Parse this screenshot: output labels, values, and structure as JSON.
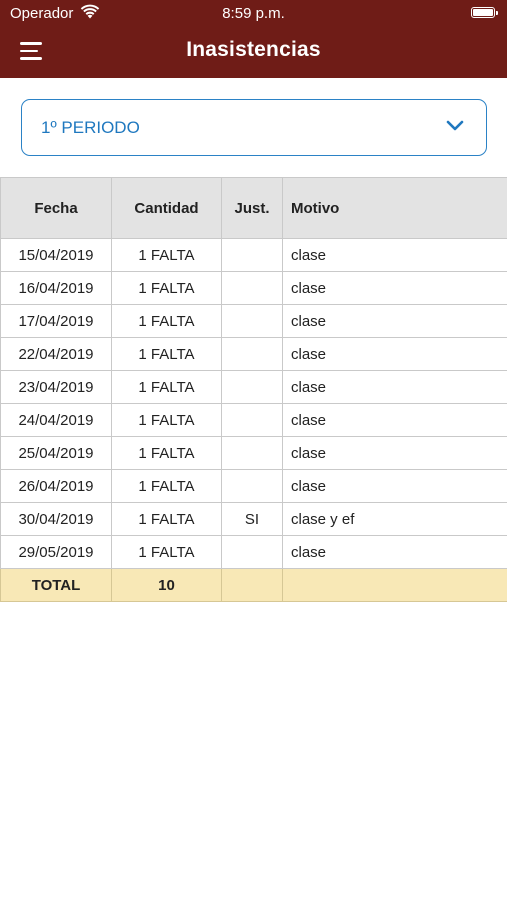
{
  "status_bar": {
    "carrier": "Operador",
    "time": "8:59 p.m."
  },
  "header": {
    "title": "Inasistencias",
    "menu_icon": "hamburger-menu-icon"
  },
  "period_select": {
    "value": "1º PERIODO",
    "icon": "chevron-down-icon"
  },
  "table": {
    "headers": [
      "Fecha",
      "Cantidad",
      "Just.",
      "Motivo"
    ],
    "rows": [
      {
        "fecha": "15/04/2019",
        "cantidad": "1 FALTA",
        "just": "",
        "motivo": "clase"
      },
      {
        "fecha": "16/04/2019",
        "cantidad": "1 FALTA",
        "just": "",
        "motivo": "clase"
      },
      {
        "fecha": "17/04/2019",
        "cantidad": "1 FALTA",
        "just": "",
        "motivo": "clase"
      },
      {
        "fecha": "22/04/2019",
        "cantidad": "1 FALTA",
        "just": "",
        "motivo": "clase"
      },
      {
        "fecha": "23/04/2019",
        "cantidad": "1 FALTA",
        "just": "",
        "motivo": "clase"
      },
      {
        "fecha": "24/04/2019",
        "cantidad": "1 FALTA",
        "just": "",
        "motivo": "clase"
      },
      {
        "fecha": "25/04/2019",
        "cantidad": "1 FALTA",
        "just": "",
        "motivo": "clase"
      },
      {
        "fecha": "26/04/2019",
        "cantidad": "1 FALTA",
        "just": "",
        "motivo": "clase"
      },
      {
        "fecha": "30/04/2019",
        "cantidad": "1 FALTA",
        "just": "SI",
        "motivo": "clase y ef"
      },
      {
        "fecha": "29/05/2019",
        "cantidad": "1 FALTA",
        "just": "",
        "motivo": "clase"
      }
    ],
    "total": {
      "label": "TOTAL",
      "value": "10"
    }
  },
  "colors": {
    "header_bg": "#6f1c17",
    "accent": "#1f78bf",
    "total_bg": "#f8e8b6"
  }
}
